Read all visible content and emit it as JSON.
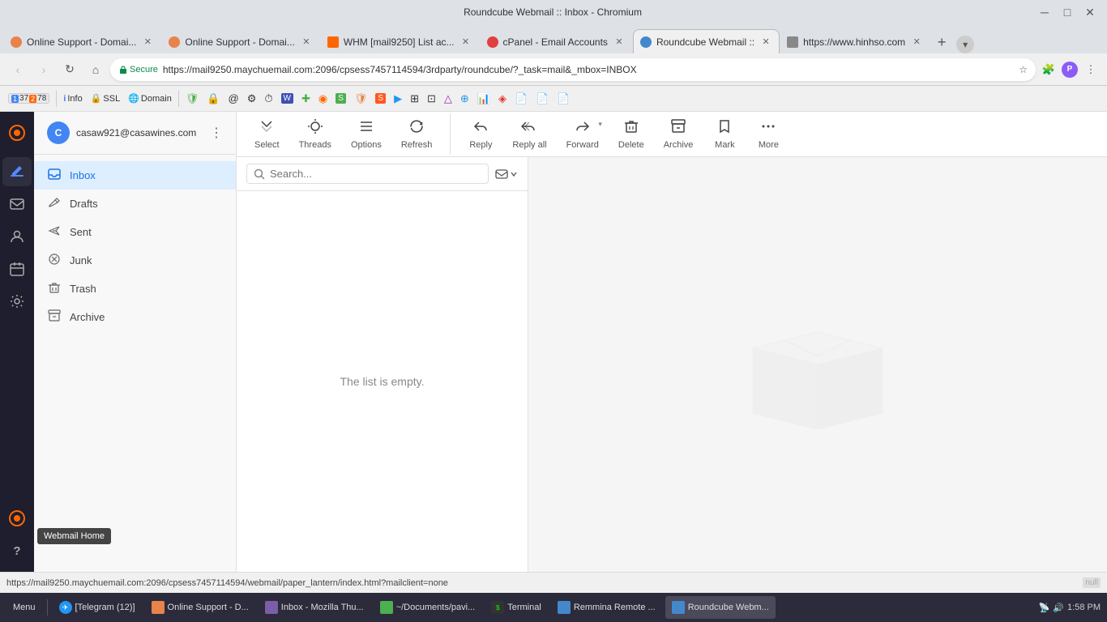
{
  "window": {
    "title": "Roundcube Webmail :: Inbox - Chromium"
  },
  "tabs": [
    {
      "id": "tab1",
      "label": "Online Support - Domai...",
      "active": false,
      "color": "#e8834a",
      "close": "×"
    },
    {
      "id": "tab2",
      "label": "Online Support - Domai...",
      "active": false,
      "color": "#e8834a",
      "close": "×"
    },
    {
      "id": "tab3",
      "label": "WHM [mail9250] List ac...",
      "active": false,
      "color": "#ff6600",
      "close": "×"
    },
    {
      "id": "tab4",
      "label": "cPanel - Email Accounts",
      "active": false,
      "color": "#e04040",
      "close": "×"
    },
    {
      "id": "tab5",
      "label": "Roundcube Webmail ::",
      "active": true,
      "color": "#4488cc",
      "close": "×"
    },
    {
      "id": "tab6",
      "label": "https://www.hinhso.com",
      "active": false,
      "color": "#888",
      "close": "×"
    }
  ],
  "address_bar": {
    "secure_text": "Secure",
    "url": "https://mail9250.maychuemail.com:2096/cpsess7457114594/3rdparty/roundcube/?_task=mail&_mbox=INBOX"
  },
  "toolbar": {
    "select_label": "Select",
    "threads_label": "Threads",
    "options_label": "Options",
    "refresh_label": "Refresh",
    "reply_label": "Reply",
    "reply_all_label": "Reply all",
    "forward_label": "Forward",
    "delete_label": "Delete",
    "archive_label": "Archive",
    "mark_label": "Mark",
    "more_label": "More"
  },
  "mail_account": {
    "email": "casaw921@casawines.com",
    "initial": "C"
  },
  "nav_items": [
    {
      "id": "inbox",
      "label": "Inbox",
      "icon": "📥",
      "active": true
    },
    {
      "id": "drafts",
      "label": "Drafts",
      "icon": "✏️",
      "active": false
    },
    {
      "id": "sent",
      "label": "Sent",
      "icon": "➤",
      "active": false
    },
    {
      "id": "junk",
      "label": "Junk",
      "icon": "🚫",
      "active": false
    },
    {
      "id": "trash",
      "label": "Trash",
      "icon": "🗑",
      "active": false
    },
    {
      "id": "archive",
      "label": "Archive",
      "icon": "🗂",
      "active": false
    }
  ],
  "search": {
    "placeholder": "Search..."
  },
  "message_list": {
    "empty_text": "The list is empty."
  },
  "tooltip": {
    "text": "Webmail Home"
  },
  "status_bar": {
    "url": "https://mail9250.maychuemail.com:2096/cpsess7457114594/webmail/paper_lantern/index.html?mailclient=none"
  },
  "taskbar": {
    "items": [
      {
        "label": "Menu",
        "active": false
      },
      {
        "label": "[Telegram (12)]",
        "active": false,
        "color": "#2196f3"
      },
      {
        "label": "Online Support - D...",
        "active": false,
        "color": "#e8834a"
      },
      {
        "label": "Inbox - Mozilla Thu...",
        "active": false,
        "color": "#7b5ea7"
      },
      {
        "label": "~/Documents/pavi...",
        "active": false,
        "color": "#4caf50"
      },
      {
        "label": "Terminal",
        "active": false,
        "color": "#333"
      },
      {
        "label": "Remmina Remote ...",
        "active": false,
        "color": "#4488cc"
      },
      {
        "label": "Roundcube Webm...",
        "active": true,
        "color": "#4488cc"
      }
    ],
    "clock": "1:58 PM",
    "null_text": "null"
  },
  "icon_sidebar": {
    "items": [
      {
        "icon": "◉",
        "label": "cpanel-icon",
        "active": false,
        "color": "#ff6600"
      },
      {
        "icon": "✏",
        "label": "compose-icon",
        "active": true
      },
      {
        "icon": "✉",
        "label": "mail-icon",
        "active": false
      },
      {
        "icon": "👤",
        "label": "contacts-icon",
        "active": false
      },
      {
        "icon": "📅",
        "label": "calendar-icon",
        "active": false
      },
      {
        "icon": "⚙",
        "label": "settings-icon",
        "active": false
      }
    ],
    "bottom_items": [
      {
        "icon": "◉",
        "label": "cpanel-bottom-icon",
        "color": "#ff6600"
      },
      {
        "icon": "?",
        "label": "help-icon"
      }
    ]
  }
}
